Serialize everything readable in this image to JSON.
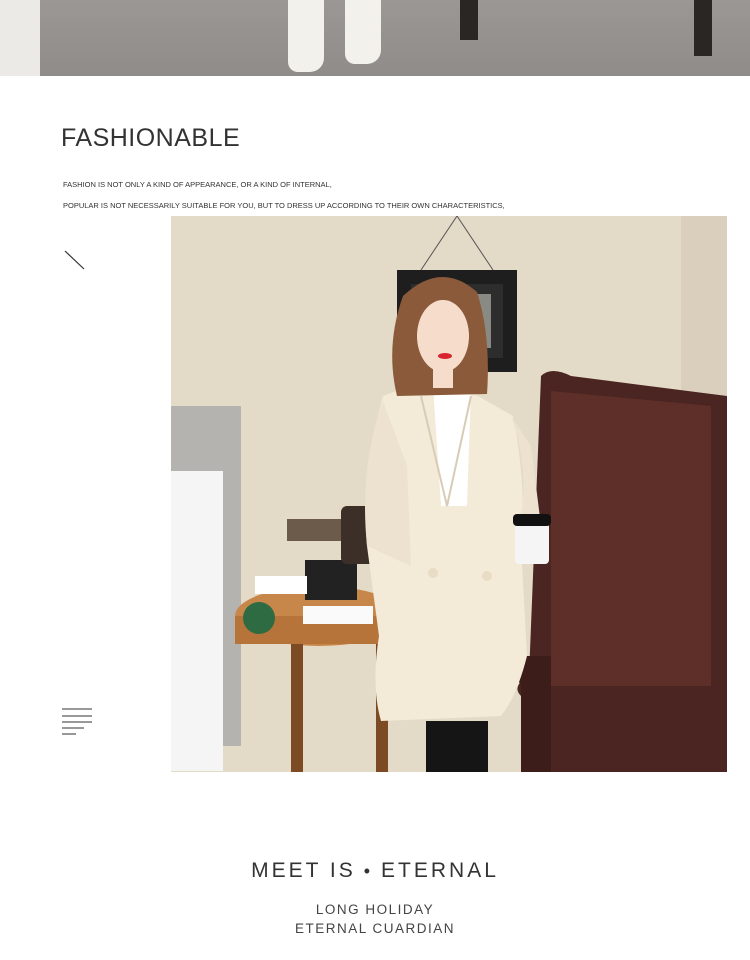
{
  "header": {
    "title": "FASHIONABLE",
    "line1": "FASHION IS NOT ONLY A KIND OF APPEARANCE, OR A KIND OF INTERNAL,",
    "line2": "POPULAR IS NOT NECESSARILY SUITABLE FOR YOU, BUT TO DRESS UP ACCORDING TO THEIR OWN CHARACTERISTICS,"
  },
  "icons": {
    "slash": "diagonal-line-icon",
    "menu": "text-lines-icon"
  },
  "footer": {
    "tagline_left": "MEET IS",
    "tagline_dot": "•",
    "tagline_right": "ETERNAL",
    "line1": "LONG HOLIDAY",
    "line2": "ETERNAL CUARDIAN"
  },
  "colors": {
    "text": "#333333",
    "coat": "#f3ead8",
    "wall": "#e5dccb",
    "leather_chair": "#4a2520",
    "table": "#c98a4c"
  }
}
